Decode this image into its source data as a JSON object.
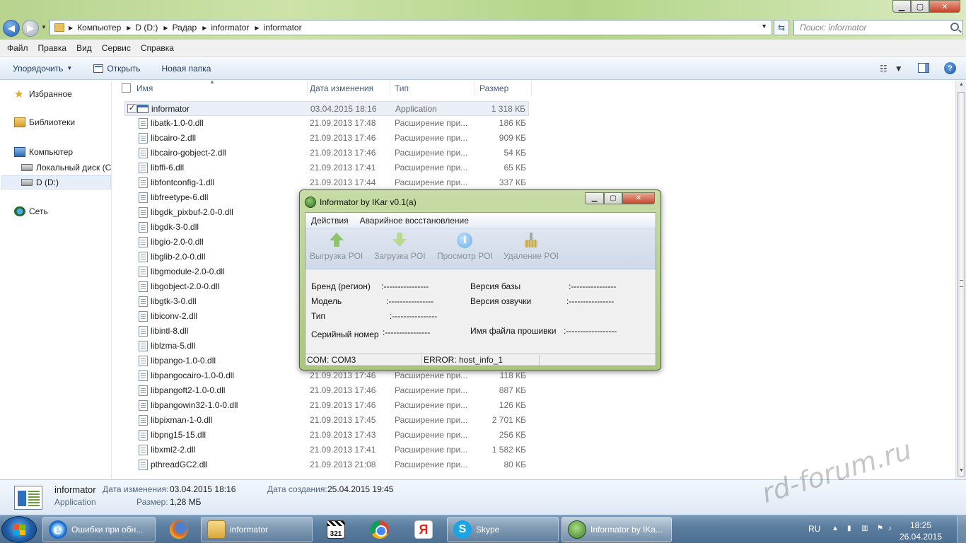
{
  "window": {
    "min_glyph": "▁",
    "max_glyph": "▢",
    "close_glyph": "✕"
  },
  "address": {
    "crumbs": [
      "Компьютер",
      "D (D:)",
      "Радар",
      "informator",
      "informator"
    ],
    "search_placeholder": "Поиск: informator"
  },
  "menubar": [
    "Файл",
    "Правка",
    "Вид",
    "Сервис",
    "Справка"
  ],
  "commands": {
    "organize": "Упорядочить",
    "open": "Открыть",
    "new_folder": "Новая папка"
  },
  "navpane": {
    "favorites": "Избранное",
    "libraries": "Библиотеки",
    "computer": "Компьютер",
    "local_disk": "Локальный диск (C",
    "d_drive": "D (D:)",
    "network": "Сеть"
  },
  "columns": {
    "name": "Имя",
    "date": "Дата изменения",
    "type": "Тип",
    "size": "Размер"
  },
  "files": [
    {
      "name": "informator",
      "date": "03.04.2015 18:16",
      "type": "Application",
      "size": "1 318 КБ"
    },
    {
      "name": "libatk-1.0-0.dll",
      "date": "21.09.2013 17:48",
      "type": "Расширение при...",
      "size": "186 КБ"
    },
    {
      "name": "libcairo-2.dll",
      "date": "21.09.2013 17:46",
      "type": "Расширение при...",
      "size": "909 КБ"
    },
    {
      "name": "libcairo-gobject-2.dll",
      "date": "21.09.2013 17:46",
      "type": "Расширение при...",
      "size": "54 КБ"
    },
    {
      "name": "libffi-6.dll",
      "date": "21.09.2013 17:41",
      "type": "Расширение при...",
      "size": "65 КБ"
    },
    {
      "name": "libfontconfig-1.dll",
      "date": "21.09.2013 17:44",
      "type": "Расширение при...",
      "size": "337 КБ"
    },
    {
      "name": "libfreetype-6.dll",
      "date": "",
      "type": "",
      "size": ""
    },
    {
      "name": "libgdk_pixbuf-2.0-0.dll",
      "date": "",
      "type": "",
      "size": ""
    },
    {
      "name": "libgdk-3-0.dll",
      "date": "",
      "type": "",
      "size": ""
    },
    {
      "name": "libgio-2.0-0.dll",
      "date": "",
      "type": "",
      "size": ""
    },
    {
      "name": "libglib-2.0-0.dll",
      "date": "",
      "type": "",
      "size": ""
    },
    {
      "name": "libgmodule-2.0-0.dll",
      "date": "",
      "type": "",
      "size": ""
    },
    {
      "name": "libgobject-2.0-0.dll",
      "date": "",
      "type": "",
      "size": ""
    },
    {
      "name": "libgtk-3-0.dll",
      "date": "",
      "type": "",
      "size": ""
    },
    {
      "name": "libiconv-2.dll",
      "date": "",
      "type": "",
      "size": ""
    },
    {
      "name": "libintl-8.dll",
      "date": "",
      "type": "",
      "size": ""
    },
    {
      "name": "liblzma-5.dll",
      "date": "",
      "type": "",
      "size": ""
    },
    {
      "name": "libpango-1.0-0.dll",
      "date": "",
      "type": "",
      "size": ""
    },
    {
      "name": "libpangocairo-1.0-0.dll",
      "date": "21.09.2013 17:46",
      "type": "Расширение при...",
      "size": "118 КБ"
    },
    {
      "name": "libpangoft2-1.0-0.dll",
      "date": "21.09.2013 17:46",
      "type": "Расширение при...",
      "size": "887 КБ"
    },
    {
      "name": "libpangowin32-1.0-0.dll",
      "date": "21.09.2013 17:46",
      "type": "Расширение при...",
      "size": "126 КБ"
    },
    {
      "name": "libpixman-1-0.dll",
      "date": "21.09.2013 17:45",
      "type": "Расширение при...",
      "size": "2 701 КБ"
    },
    {
      "name": "libpng15-15.dll",
      "date": "21.09.2013 17:43",
      "type": "Расширение при...",
      "size": "256 КБ"
    },
    {
      "name": "libxml2-2.dll",
      "date": "21.09.2013 17:41",
      "type": "Расширение при...",
      "size": "1 582 КБ"
    },
    {
      "name": "pthreadGC2.dll",
      "date": "21.09.2013 21:08",
      "type": "Расширение при...",
      "size": "80 КБ"
    }
  ],
  "details": {
    "name": "informator",
    "kind": "Application",
    "modified_label": "Дата изменения:",
    "modified": "03.04.2015 18:16",
    "created_label": "Дата создания:",
    "created": "25.04.2015 19:45",
    "size_label": "Размер:",
    "size": "1,28 МБ"
  },
  "watermark": "rd-forum.ru",
  "dialog": {
    "title": "Informator by IKar v0.1(a)",
    "menu": [
      "Действия",
      "Аварийное восстановление"
    ],
    "toolbar": [
      "Выгрузка POI",
      "Загрузка POI",
      "Просмотр POI",
      "Удаление POI"
    ],
    "fields": {
      "brand_label": "Бренд (регион)",
      "brand_value": ":----------------",
      "model_label": "Модель",
      "model_value": ":----------------",
      "type_label": "Тип",
      "type_value": ":----------------",
      "serial_label": "Серийный номер",
      "serial_value": ":----------------",
      "db_version_label": "Версия базы",
      "db_version_value": ":----------------",
      "voice_version_label": "Версия озвучки",
      "voice_version_value": ":----------------",
      "firmware_label": "Имя файла прошивки",
      "firmware_value": ":------------------"
    },
    "status": {
      "com": "COM: COM3",
      "error": "ERROR: host_info_1"
    }
  },
  "taskbar": {
    "items": [
      {
        "label": "Ошибки при обн...",
        "icon": "internet-explorer-icon"
      },
      {
        "label": "",
        "icon": "firefox-icon"
      },
      {
        "label": "informator",
        "icon": "folder-icon"
      },
      {
        "label": "321",
        "icon": "media-player-classic-icon"
      },
      {
        "label": "",
        "icon": "chrome-icon"
      },
      {
        "label": "Я",
        "icon": "yandex-icon"
      },
      {
        "label": "Skype",
        "icon": "skype-icon"
      },
      {
        "label": "Informator by IKa...",
        "icon": "informator-icon"
      }
    ],
    "lang": "RU",
    "time": "18:25",
    "date": "26.04.2015"
  }
}
